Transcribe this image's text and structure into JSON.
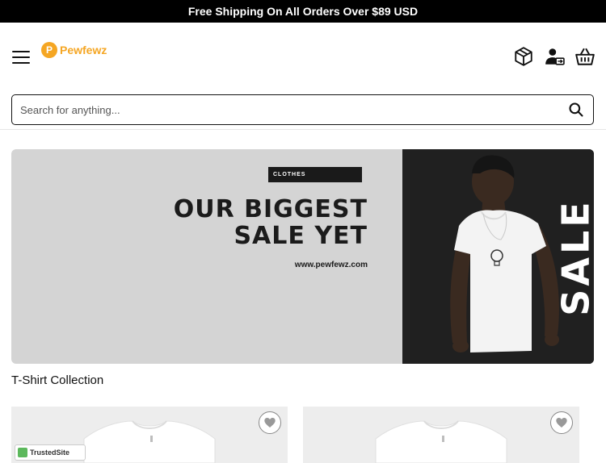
{
  "topbar": {
    "text": "Free Shipping On All Orders Over $89 USD"
  },
  "header": {
    "logo_text": "Pewfewz",
    "logo_mark": "P",
    "icons": [
      "menu-icon",
      "box-icon",
      "account-icon",
      "basket-icon"
    ]
  },
  "search": {
    "placeholder": "Search for anything..."
  },
  "banner": {
    "tag": "CLOTHES",
    "headline_line1": "OUR BIGGEST",
    "headline_line2": "SALE YET",
    "url": "www.pewfewz.com",
    "side_word": "SALE"
  },
  "section": {
    "title": "T-Shirt Collection"
  },
  "products": [
    {
      "image": "white-tshirt"
    },
    {
      "image": "white-tshirt"
    }
  ],
  "trust_badge": {
    "label": "TrustedSite"
  },
  "colors": {
    "accent": "#f5a623",
    "topbar_bg": "#000000",
    "banner_bg": "#d4d4d4",
    "card_bg": "#ededed"
  }
}
